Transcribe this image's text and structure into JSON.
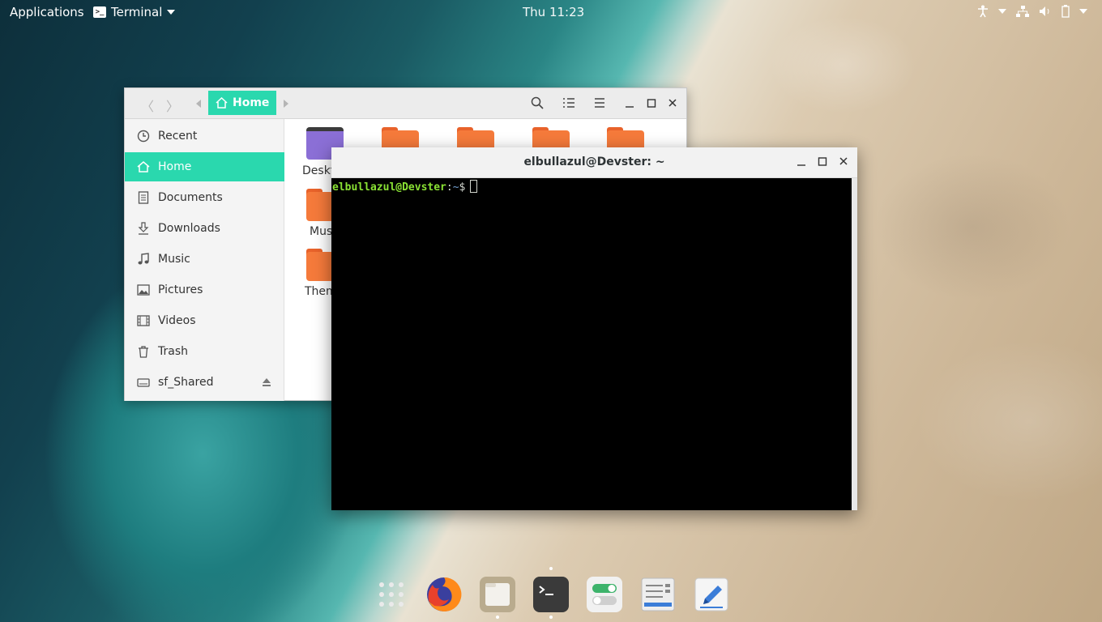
{
  "top_panel": {
    "applications": "Applications",
    "app_name": "Terminal",
    "clock": "Thu 11:23"
  },
  "files": {
    "path_home": "Home",
    "sidebar": [
      {
        "label": "Recent",
        "icon": "clock-icon"
      },
      {
        "label": "Home",
        "icon": "home-icon"
      },
      {
        "label": "Documents",
        "icon": "document-icon"
      },
      {
        "label": "Downloads",
        "icon": "download-icon"
      },
      {
        "label": "Music",
        "icon": "music-icon"
      },
      {
        "label": "Pictures",
        "icon": "picture-icon"
      },
      {
        "label": "Videos",
        "icon": "film-icon"
      },
      {
        "label": "Trash",
        "icon": "trash-icon"
      },
      {
        "label": "sf_Shared",
        "icon": "drive-icon"
      }
    ],
    "folders_visible_labels": [
      "Deskt",
      "Mus",
      "Them"
    ]
  },
  "terminal": {
    "title": "elbullazul@Devster: ~",
    "prompt_user": "elbullazul@Devster",
    "prompt_sep": ":",
    "prompt_path": "~",
    "prompt_symbol": "$"
  },
  "dock": [
    "app-grid-icon",
    "firefox-icon",
    "files-icon",
    "terminal-icon",
    "settings-icon",
    "software-icon",
    "text-editor-icon"
  ],
  "colors": {
    "accent": "#2ad8ae",
    "folder_orange": "#f57a3b",
    "desktop_folder": "#8b6fd6"
  }
}
